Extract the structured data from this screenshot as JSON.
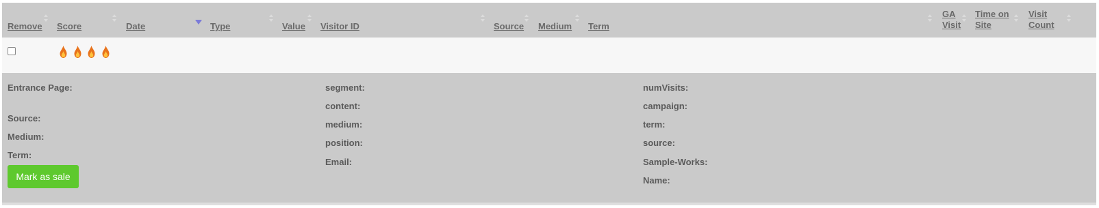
{
  "columns": {
    "remove": "Remove",
    "score": "Score",
    "date": "Date",
    "type": "Type",
    "value": "Value",
    "visitor_id": "Visitor ID",
    "source": "Source",
    "medium": "Medium",
    "term": "Term",
    "ga_visit_1": "GA",
    "ga_visit_2": "Visit",
    "time_on_site_1": "Time on",
    "time_on_site_2": "Site",
    "visit_count_1": "Visit",
    "visit_count_2": "Count"
  },
  "row": {
    "checked": false,
    "score": 4,
    "score_icon": "flame-icon"
  },
  "details": {
    "col1": {
      "entrance_page": "Entrance Page:",
      "source": "Source:",
      "medium": "Medium:",
      "term": "Term:"
    },
    "col2": {
      "segment": "segment:",
      "content": "content:",
      "medium": "medium:",
      "position": "position:",
      "email": "Email:"
    },
    "col3": {
      "num_visits": "numVisits:",
      "campaign": "campaign:",
      "term": "term:",
      "source": "source:",
      "sample_works": "Sample-Works:",
      "name": "Name:"
    },
    "mark_as_sale": "Mark as sale"
  },
  "colors": {
    "header_bg": "#cacaca",
    "row_bg": "#f7f7f7",
    "button_green": "#5ec92e",
    "sort_active": "#7b7bd8",
    "flame_outer": "#e8731c",
    "flame_inner": "#ffc23d"
  }
}
